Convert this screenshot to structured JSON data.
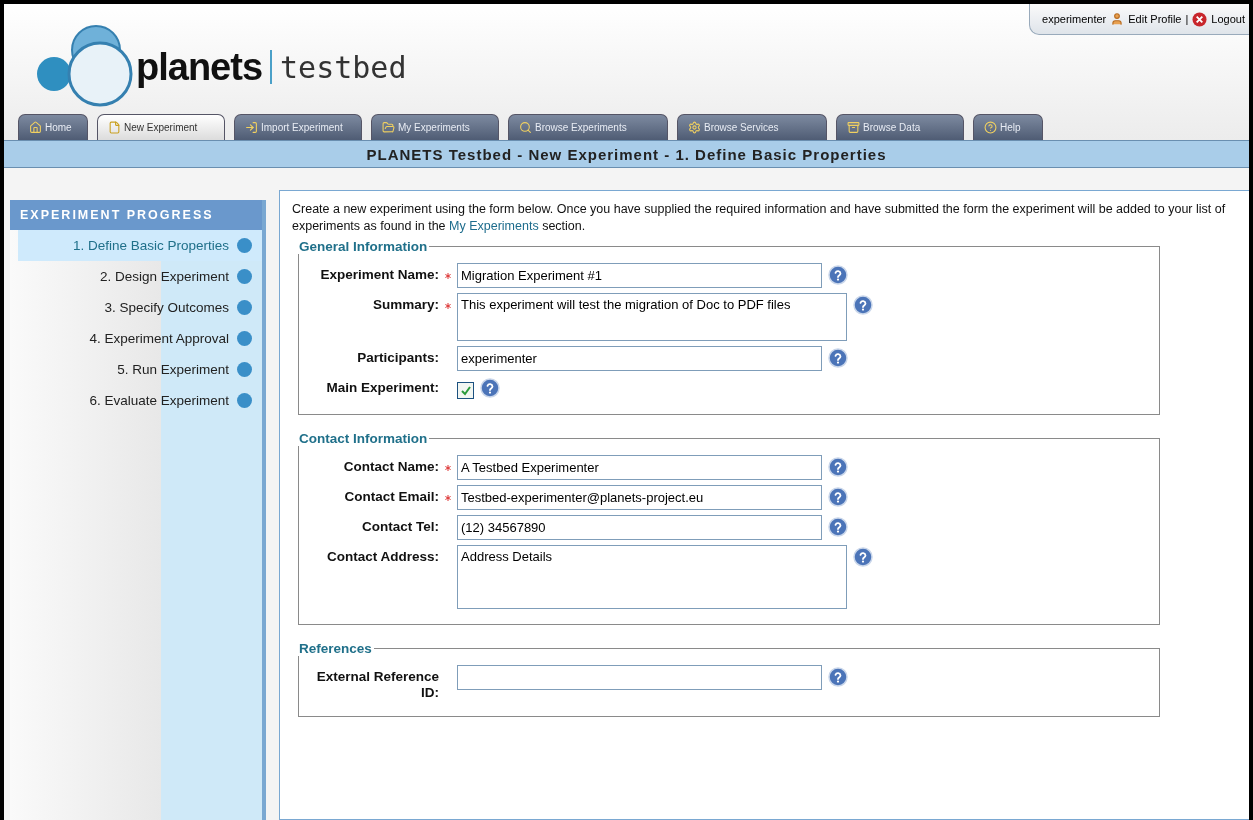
{
  "user_bar": {
    "username": "experimenter",
    "edit_profile": "Edit Profile",
    "separator": "|",
    "logout": "Logout"
  },
  "logo": {
    "name": "planets",
    "product": "testbed"
  },
  "tabs": [
    {
      "label": "Home",
      "selected": false
    },
    {
      "label": "New Experiment",
      "selected": true
    },
    {
      "label": "Import Experiment",
      "selected": false
    },
    {
      "label": "My Experiments",
      "selected": false
    },
    {
      "label": "Browse Experiments",
      "selected": false
    },
    {
      "label": "Browse Services",
      "selected": false
    },
    {
      "label": "Browse Data",
      "selected": false
    },
    {
      "label": "Help",
      "selected": false
    }
  ],
  "page_title": "PLANETS Testbed - New Experiment - 1. Define Basic Properties",
  "sidebar": {
    "title": "EXPERIMENT PROGRESS",
    "items": [
      {
        "label": "1. Define Basic Properties",
        "selected": true
      },
      {
        "label": "2. Design Experiment",
        "selected": false
      },
      {
        "label": "3. Specify Outcomes",
        "selected": false
      },
      {
        "label": "4. Experiment Approval",
        "selected": false
      },
      {
        "label": "5. Run Experiment",
        "selected": false
      },
      {
        "label": "6. Evaluate Experiment",
        "selected": false
      }
    ]
  },
  "intro": {
    "before": "Create a new experiment using the form below. Once you have supplied the required information and have submitted the form the experiment will be added to your list of experiments as found in the ",
    "link": "My Experiments",
    "after": " section."
  },
  "sections": [
    {
      "title": "General Information",
      "fields": [
        {
          "kind": "text",
          "label": "Experiment Name:",
          "required": true,
          "value": "Migration Experiment #1"
        },
        {
          "kind": "textarea",
          "label": "Summary:",
          "required": true,
          "value": "This experiment will test the migration of Doc to PDF files"
        },
        {
          "kind": "text",
          "label": "Participants:",
          "required": false,
          "value": "experimenter"
        },
        {
          "kind": "checkbox",
          "label": "Main Experiment:",
          "required": false,
          "checked": true
        }
      ]
    },
    {
      "title": "Contact Information",
      "fields": [
        {
          "kind": "text",
          "label": "Contact Name:",
          "required": true,
          "value": "A Testbed Experimenter"
        },
        {
          "kind": "text",
          "label": "Contact Email:",
          "required": true,
          "value": "Testbed-experimenter@planets-project.eu"
        },
        {
          "kind": "text",
          "label": "Contact Tel:",
          "required": false,
          "value": "(12) 34567890"
        },
        {
          "kind": "bigtext",
          "label": "Contact Address:",
          "required": false,
          "value": "Address Details"
        }
      ]
    },
    {
      "title": "References",
      "fields": [
        {
          "kind": "text",
          "label": "External Reference ID:",
          "required": false
        }
      ]
    }
  ]
}
